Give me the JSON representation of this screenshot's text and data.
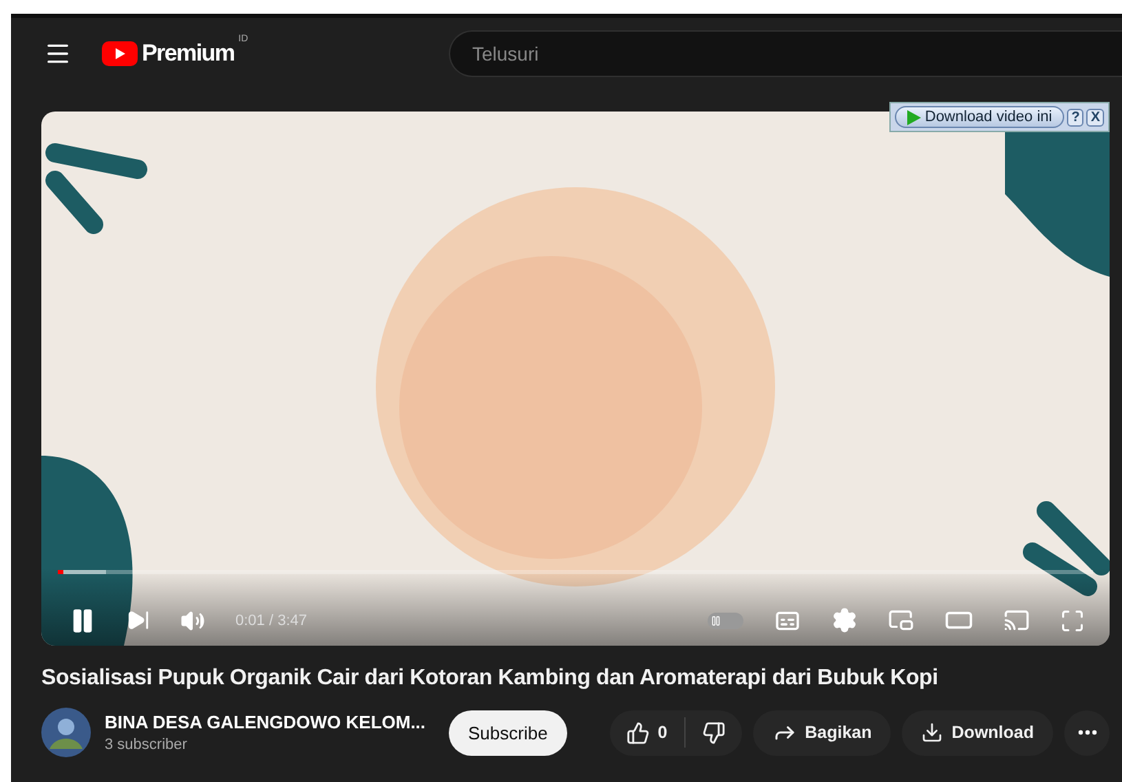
{
  "header": {
    "logo": "Premium",
    "region": "ID",
    "search": {
      "placeholder": "Telusuri"
    }
  },
  "download_bar": {
    "label": "Download video ini",
    "help": "?",
    "close": "X"
  },
  "player": {
    "progress": {
      "level": 0.005
    },
    "time": "0:01 / 3:47",
    "playing": true,
    "autoplay": {
      "on": false
    }
  },
  "video_title": "Sosialisasi Pupuk Organik Cair dari Kotoran Kambing dan Aromaterapi dari Bubuk Kopi",
  "channel": {
    "name": "BINA DESA GALENGDOWO KELOM...",
    "subscribers": "3 subscriber",
    "subscribe": "Subscribe"
  },
  "actions": {
    "likes": "0",
    "share": "Bagikan",
    "download": "Download"
  }
}
